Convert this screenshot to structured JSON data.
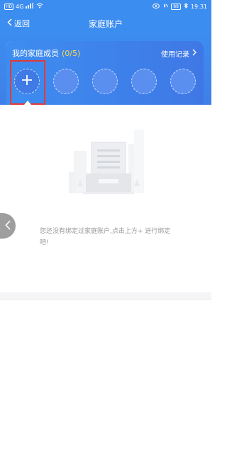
{
  "status_bar": {
    "hd_badge": "HD",
    "network": "4G",
    "battery": "88",
    "time": "19:31"
  },
  "nav": {
    "back_label": "返回",
    "title": "家庭账户"
  },
  "members": {
    "title": "我的家庭成员",
    "count": "(0/5)",
    "usage_link": "使用记录",
    "slots": [
      "add",
      "empty",
      "empty",
      "empty",
      "empty"
    ]
  },
  "empty_state": {
    "message": "您还没有绑定过家庭账户,点击上方+ 进行绑定吧!"
  },
  "colors": {
    "primary": "#3c8df0",
    "count_yellow": "#ffd84a",
    "highlight_red": "#e53935"
  },
  "icons": [
    "wifi-icon",
    "signal-icon",
    "eye-icon",
    "mute-icon",
    "bluetooth-icon",
    "battery-icon",
    "chevron-left-icon",
    "chevron-right-icon",
    "plus-icon",
    "document-illustration"
  ]
}
